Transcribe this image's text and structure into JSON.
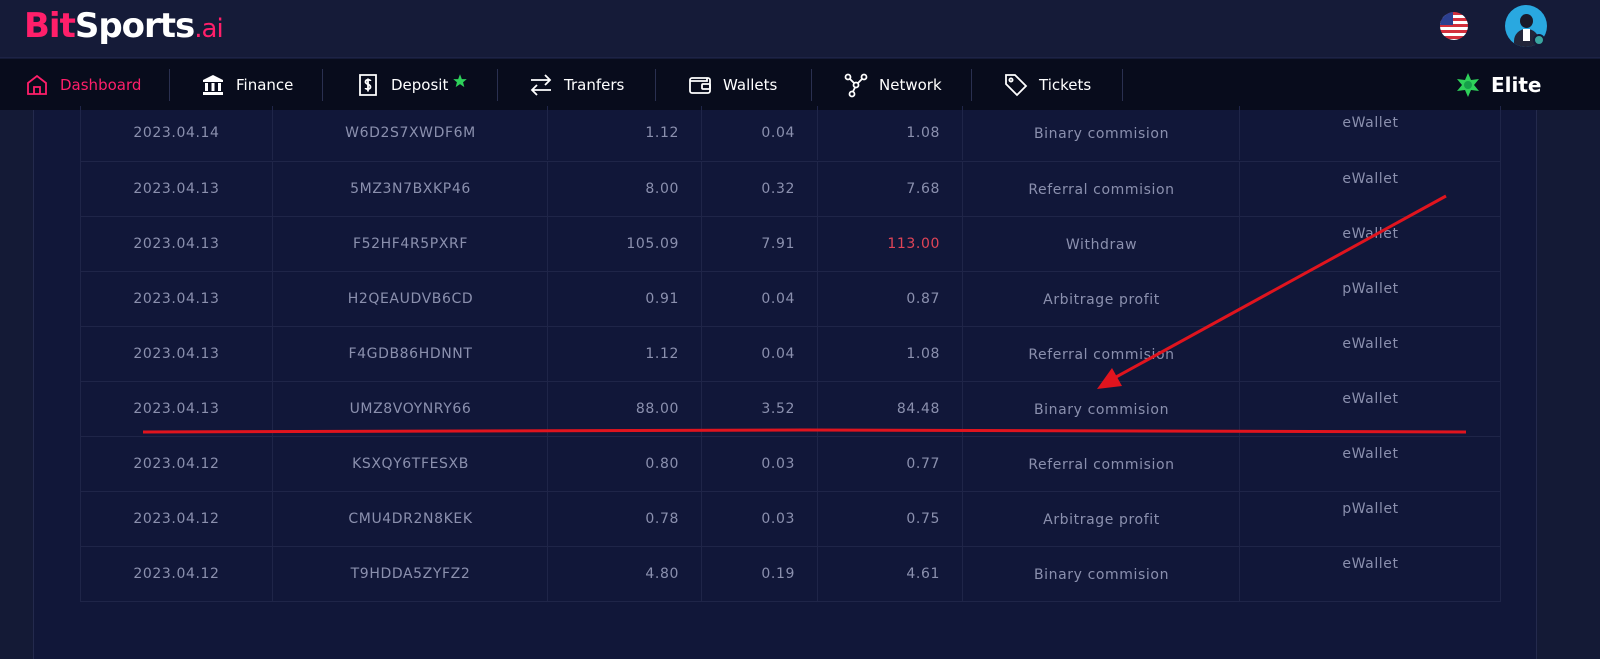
{
  "brand": {
    "bit": "Bit",
    "sports": "Sports",
    "ai": ".ai"
  },
  "header": {
    "flag_icon": "us-flag-icon",
    "avatar_icon": "user-avatar-icon"
  },
  "nav": {
    "items": [
      {
        "label": "Dashboard",
        "icon": "home-icon",
        "active": true
      },
      {
        "label": "Finance",
        "icon": "bank-icon"
      },
      {
        "label": "Deposit",
        "icon": "deposit-icon"
      },
      {
        "label": "Tranfers",
        "icon": "transfer-arrows-icon"
      },
      {
        "label": "Wallets",
        "icon": "wallet-icon"
      },
      {
        "label": "Network",
        "icon": "network-icon"
      },
      {
        "label": "Tickets",
        "icon": "tag-icon"
      }
    ],
    "rank_label": "Elite"
  },
  "colors": {
    "accent": "#ff1f6a",
    "green": "#2ed15a",
    "negative": "#e04457",
    "annotation": "#e0141e"
  },
  "transactions": [
    {
      "date": "2023.04.14",
      "code": "W6D2S7XWDF6M",
      "amount": "1.12",
      "fee": "0.04",
      "net": "1.08",
      "type": "Binary commision",
      "wallet": "eWallet"
    },
    {
      "date": "2023.04.13",
      "code": "5MZ3N7BXKP46",
      "amount": "8.00",
      "fee": "0.32",
      "net": "7.68",
      "type": "Referral commision",
      "wallet": "eWallet"
    },
    {
      "date": "2023.04.13",
      "code": "F52HF4R5PXRF",
      "amount": "105.09",
      "fee": "7.91",
      "net": "113.00",
      "type": "Withdraw",
      "wallet": "eWallet"
    },
    {
      "date": "2023.04.13",
      "code": "H2QEAUDVB6CD",
      "amount": "0.91",
      "fee": "0.04",
      "net": "0.87",
      "type": "Arbitrage profit",
      "wallet": "pWallet"
    },
    {
      "date": "2023.04.13",
      "code": "F4GDB86HDNNT",
      "amount": "1.12",
      "fee": "0.04",
      "net": "1.08",
      "type": "Referral commision",
      "wallet": "eWallet"
    },
    {
      "date": "2023.04.13",
      "code": "UMZ8VOYNRY66",
      "amount": "88.00",
      "fee": "3.52",
      "net": "84.48",
      "type": "Binary commision",
      "wallet": "eWallet"
    },
    {
      "date": "2023.04.12",
      "code": "KSXQY6TFESXB",
      "amount": "0.80",
      "fee": "0.03",
      "net": "0.77",
      "type": "Referral commision",
      "wallet": "eWallet"
    },
    {
      "date": "2023.04.12",
      "code": "CMU4DR2N8KEK",
      "amount": "0.78",
      "fee": "0.03",
      "net": "0.75",
      "type": "Arbitrage profit",
      "wallet": "pWallet"
    },
    {
      "date": "2023.04.12",
      "code": "T9HDDA5ZYFZ2",
      "amount": "4.80",
      "fee": "0.19",
      "net": "4.61",
      "type": "Binary commision",
      "wallet": "eWallet"
    }
  ]
}
